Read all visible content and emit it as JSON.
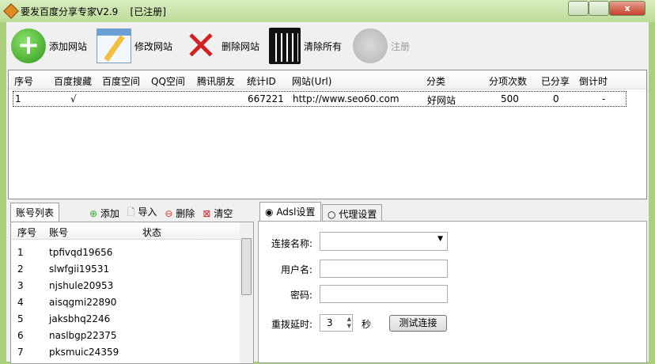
{
  "window": {
    "title": "要发百度分享专家V2.9    [已注册]"
  },
  "toolbar": {
    "add": "添加网站",
    "edit": "修改网站",
    "delete": "删除网站",
    "clear": "清除所有",
    "register": "注册"
  },
  "sites": {
    "columns": [
      "序号",
      "百度搜藏",
      "百度空间",
      "QQ空间",
      "腾讯朋友",
      "统计ID",
      "网站(Url)",
      "分类",
      "分项次数",
      "已分享",
      "倒计时"
    ],
    "rows": [
      [
        "1",
        "√",
        "",
        "",
        "",
        "667221",
        "http://www.seo60.com",
        "好网站",
        "500",
        "0",
        "-"
      ]
    ]
  },
  "accounts": {
    "tab": "账号列表",
    "add": "添加",
    "import": "导入",
    "delete": "删除",
    "clear": "清空",
    "columns": [
      "序号",
      "账号",
      "状态"
    ],
    "rows": [
      [
        "1",
        "tpfivqd19656",
        ""
      ],
      [
        "2",
        "slwfgii19531",
        ""
      ],
      [
        "3",
        "njshule20953",
        ""
      ],
      [
        "4",
        "aisqgmi22890",
        ""
      ],
      [
        "5",
        "jaksbhq2246",
        ""
      ],
      [
        "6",
        "naslbgp22375",
        ""
      ],
      [
        "7",
        "pksmuic24359",
        ""
      ]
    ]
  },
  "settings": {
    "tab_adsl": "Adsl设置",
    "tab_proxy": "代理设置",
    "conn_label": "连接名称:",
    "conn_value": "",
    "user_label": "用户名:",
    "user_value": "",
    "pwd_label": "密码:",
    "pwd_value": "",
    "delay_label": "重拨延时:",
    "delay_value": "3",
    "delay_unit": "秒",
    "test_button": "测试连接"
  }
}
